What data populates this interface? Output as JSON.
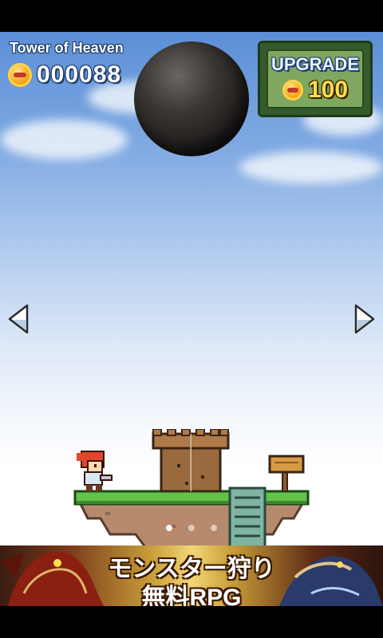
{
  "game": {
    "title": "Tower of Heaven",
    "coin_count": "000088",
    "coin_icon": "gold-coin-icon",
    "upgrade": {
      "label": "UPGRADE",
      "cost": "100"
    },
    "navigation": {
      "left_icon": "triangle-left-icon",
      "right_icon": "triangle-right-icon"
    },
    "pager": {
      "page_count": 3,
      "current_page": 1
    }
  },
  "ad": {
    "line1": "モンスター狩り",
    "line2": "無料RPG"
  },
  "colors": {
    "upgrade_panel": "#355a2b",
    "upgrade_face": "#7fa760",
    "cost_text": "#ffde4a",
    "sky_top": "#5b8fd6"
  }
}
